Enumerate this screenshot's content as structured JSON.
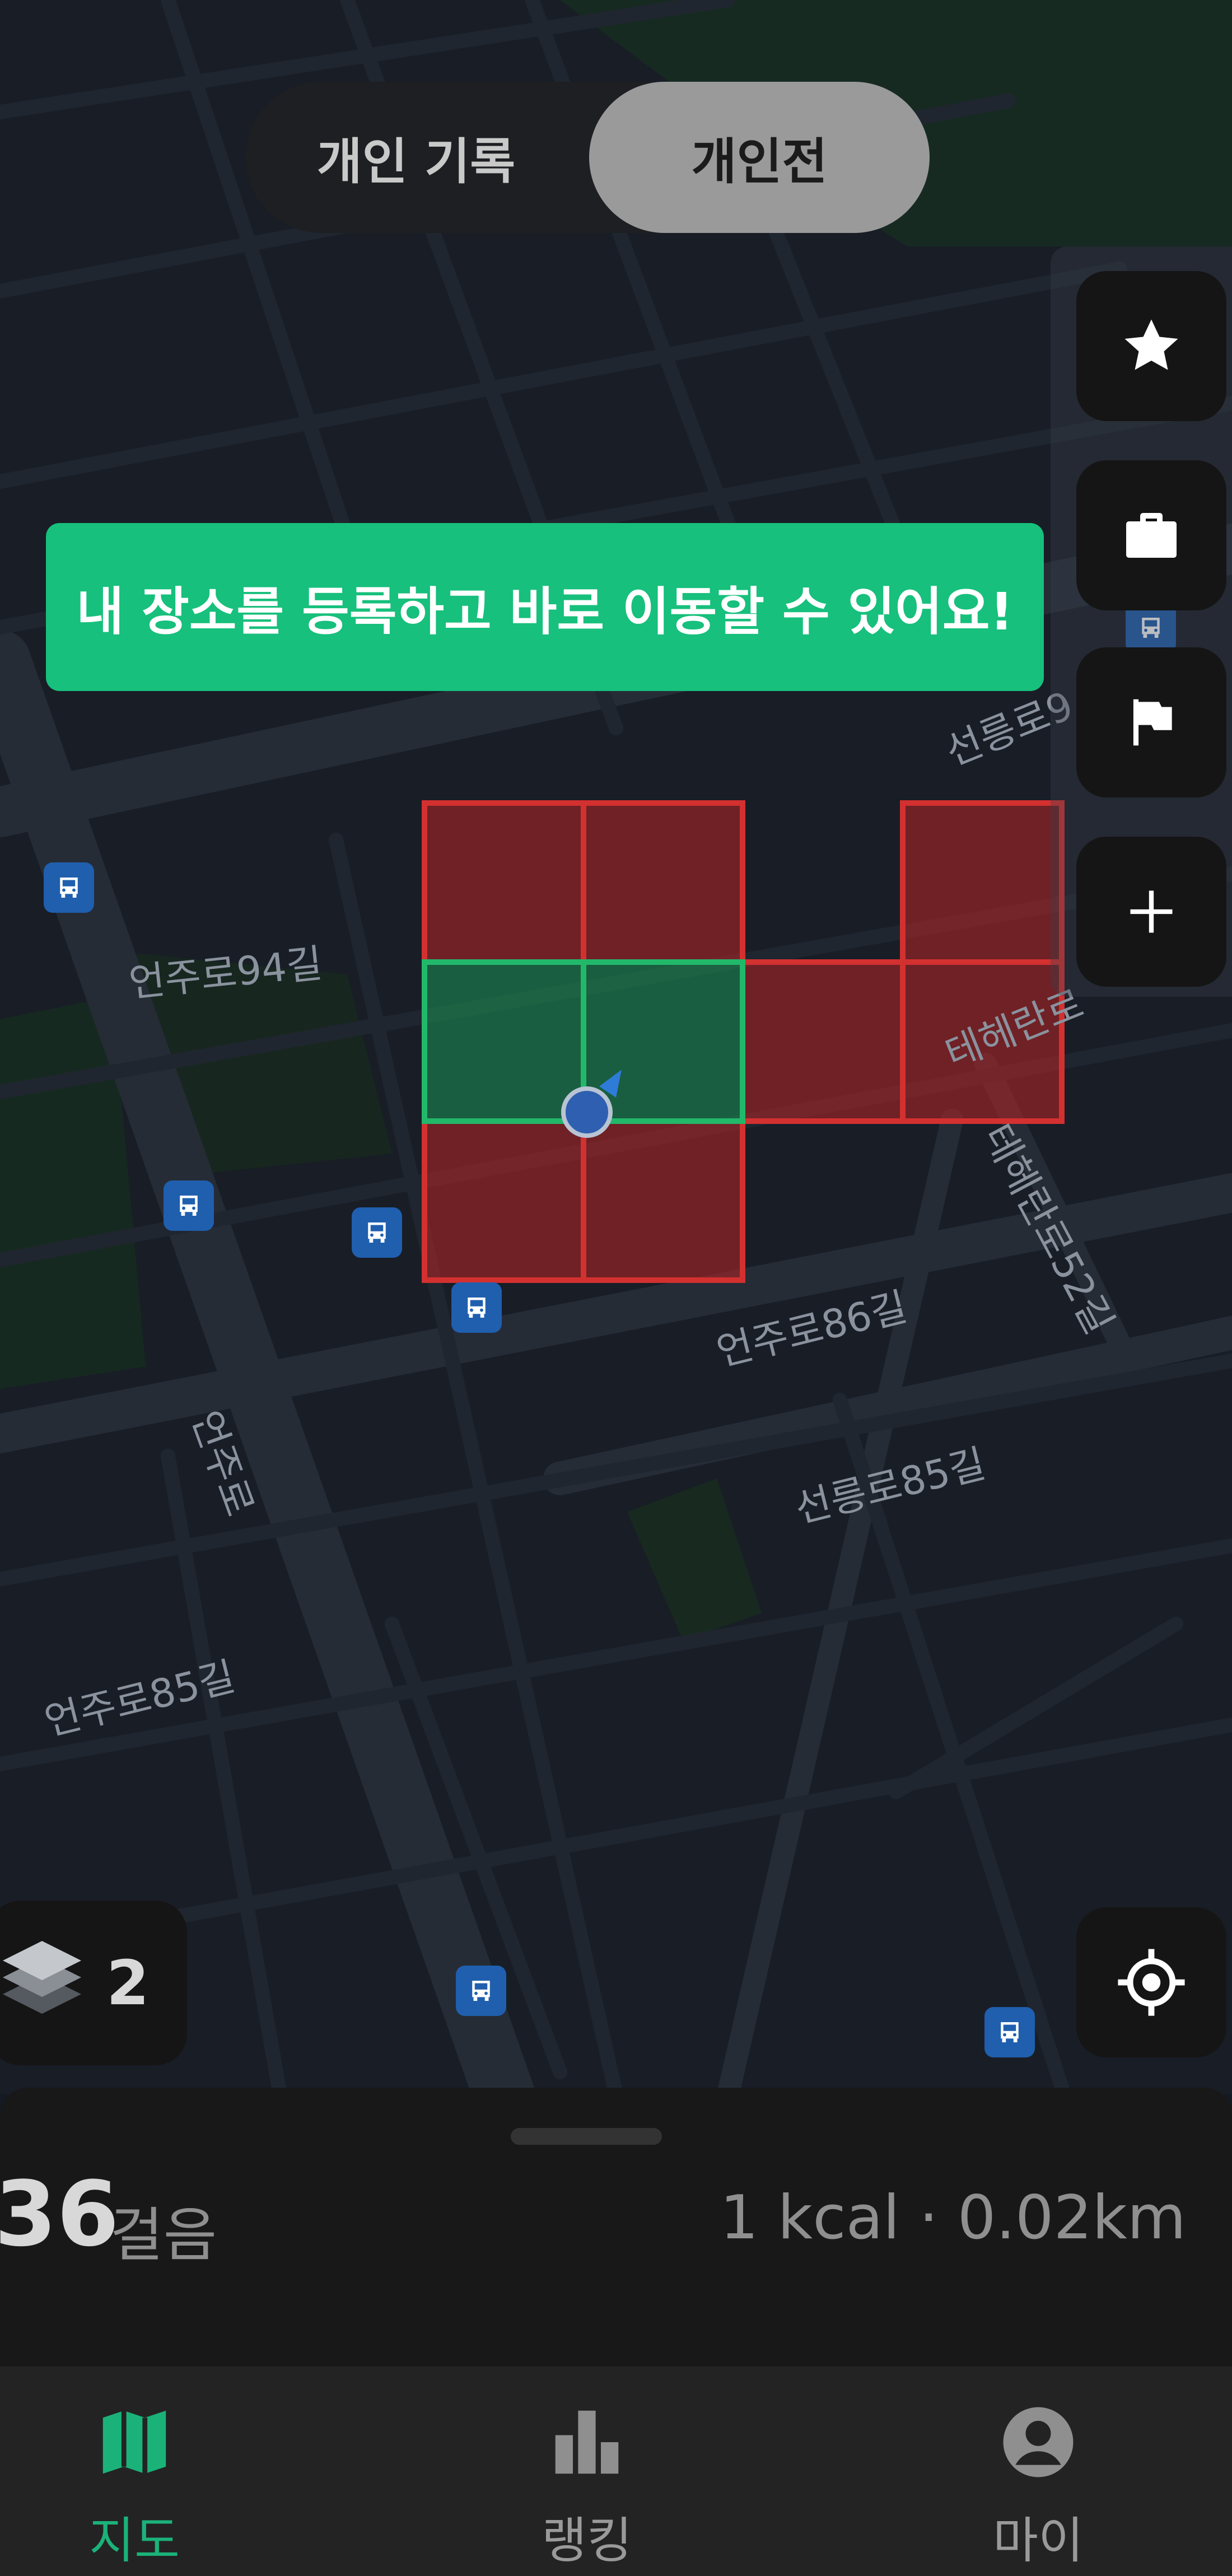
{
  "toggle": {
    "personal_label": "개인 기록",
    "battle_label": "개인전",
    "selected": "개인전"
  },
  "tooltip": {
    "text": "내 장소를 등록하고 바로 이동할 수 있어요!"
  },
  "right_rail": {
    "icons": [
      "star-icon",
      "briefcase-icon",
      "flag-icon",
      "plus-icon"
    ]
  },
  "map": {
    "street_labels": [
      "선릉로9",
      "언주로94길",
      "테헤란로",
      "테헤란로52길",
      "언주로86길",
      "언주로",
      "선릉로85길",
      "언주로85길"
    ],
    "grid_cells": {
      "red": [
        "r0c0",
        "r0c1",
        "r0c4",
        "r1c2",
        "r1c3",
        "r1c4",
        "r2c0",
        "r2c1"
      ],
      "green": [
        "r1c0",
        "r1c1"
      ]
    },
    "colors": {
      "red_cell": "#b82424",
      "green_cell": "#1a8a52",
      "user_marker": "#2f5fb0"
    }
  },
  "layer_control": {
    "count": "2"
  },
  "stats": {
    "steps": "36",
    "steps_unit": "걸음",
    "summary": "1 kcal · 0.02km"
  },
  "nav": {
    "items": [
      {
        "label": "지도",
        "icon": "map-icon",
        "active": true
      },
      {
        "label": "랭킹",
        "icon": "bar-chart-icon",
        "active": false
      },
      {
        "label": "마이",
        "icon": "profile-icon",
        "active": false
      }
    ]
  },
  "colors": {
    "accent": "#1bb27a",
    "tooltip_bg": "#17c07c"
  }
}
